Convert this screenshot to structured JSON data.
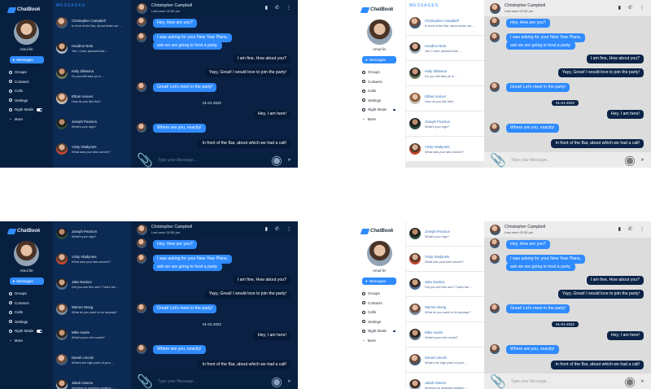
{
  "app": {
    "name": "ChatBook"
  },
  "user": {
    "name": "Amul lin"
  },
  "sidebar": {
    "messages_label": "Messages",
    "menu": [
      "Groups",
      "Contacts",
      "Calls",
      "Settings",
      "Night Mode",
      "More"
    ]
  },
  "list_title": "MESSAGES",
  "contacts_a": [
    {
      "name": "Christopher Campbell",
      "preview": "In front of the Bar, about which we ..."
    },
    {
      "name": "Houdine Nela",
      "preview": "Yes, I have planned that ..."
    },
    {
      "name": "Kelly Sikkema",
      "preview": "Do you still take ye m ..."
    },
    {
      "name": "Ethan Hoover",
      "preview": "How do you like this?"
    },
    {
      "name": "Joseph Pearson",
      "preview": "What's your sign?"
    },
    {
      "name": "Vicky Hladynets",
      "preview": "What was your last concert?"
    },
    {
      "name": "Jake Nackos",
      "preview": ""
    }
  ],
  "contacts_b": [
    {
      "name": "Joseph Pearson",
      "preview": "What's your sign?"
    },
    {
      "name": "Vicky Hladynets",
      "preview": "What was your last concert?"
    },
    {
      "name": "Jake Nackos",
      "preview": "Did you see this one? That's the ..."
    },
    {
      "name": "Warren Wong",
      "preview": "What do you want to do anyway?"
    },
    {
      "name": "Mike Austin",
      "preview": "What's your role model?"
    },
    {
      "name": "Daniel Lincoln",
      "preview": "What's the high point of your ..."
    },
    {
      "name": "Jakob Owens",
      "preview": "Working on anything exciting ..."
    }
  ],
  "chat": {
    "name": "Christopher Campbell",
    "last_seen": "Last seen 02:55 pm",
    "input_placeholder": "Type your Message...",
    "date": "01-01-2022",
    "messages": [
      {
        "dir": "in",
        "text": "Hey, How are you?"
      },
      {
        "dir": "in",
        "text": "I was asking for your New Year Plans,"
      },
      {
        "dir": "in",
        "text": "ask we are going to host a party."
      },
      {
        "dir": "out",
        "text": "I am fine, How about you?"
      },
      {
        "dir": "out",
        "text": "Yayy, Great! I would love to join the party!"
      },
      {
        "dir": "in",
        "text": "Great! Let's meet in the party!"
      },
      {
        "dir": "out",
        "text": "Hey, I am here!"
      },
      {
        "dir": "in",
        "text": "Where are you, exactly!"
      },
      {
        "dir": "out",
        "text": "In front of the Bar, about which we had a call!"
      }
    ]
  },
  "colors": {
    "accent": "#2f8bff",
    "navy": "#0b2447"
  }
}
